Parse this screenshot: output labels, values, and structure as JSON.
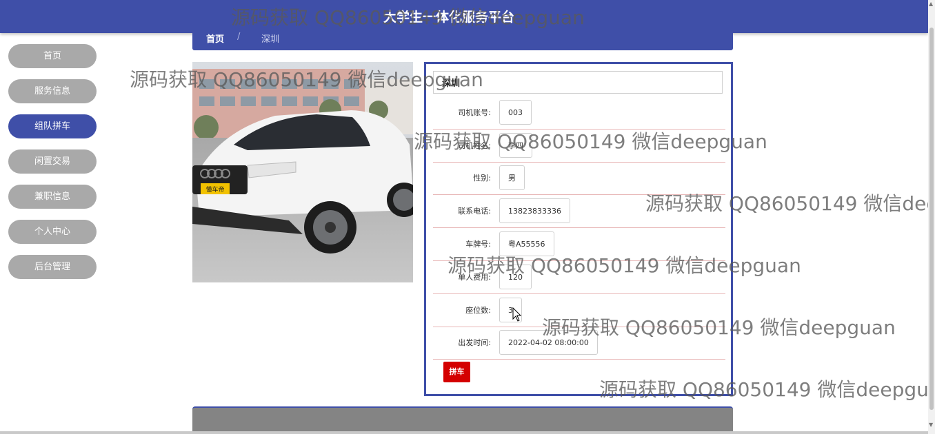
{
  "header": {
    "title": "大学生一体化服务平台"
  },
  "nav": {
    "items": [
      {
        "label": "首页"
      },
      {
        "label": "服务信息"
      },
      {
        "label": "组队拼车",
        "active": true
      },
      {
        "label": "闲置交易"
      },
      {
        "label": "兼职信息"
      },
      {
        "label": "个人中心"
      },
      {
        "label": "后台管理"
      }
    ]
  },
  "breadcrumb": {
    "home": "首页",
    "separator": "/",
    "current": "深圳"
  },
  "detail": {
    "name": "深圳",
    "fields": [
      {
        "label": "司机账号:",
        "value": "003"
      },
      {
        "label": "司机姓名:",
        "value": "李四"
      },
      {
        "label": "性别:",
        "value": "男"
      },
      {
        "label": "联系电话:",
        "value": "13823833336"
      },
      {
        "label": "车牌号:",
        "value": "粤A55556"
      },
      {
        "label": "单人费用:",
        "value": "120"
      },
      {
        "label": "座位数:",
        "value": "3"
      },
      {
        "label": "出发时间:",
        "value": "2022-04-02 08:00:00"
      }
    ],
    "join_button": "拼车"
  },
  "photo": {
    "plate_label": "懂车帝"
  },
  "watermark": "源码获取 QQ86050149 微信deepguan",
  "colors": {
    "primary": "#3f4fa8",
    "nav_inactive": "#a9a9a9",
    "action_red": "#d40000"
  }
}
